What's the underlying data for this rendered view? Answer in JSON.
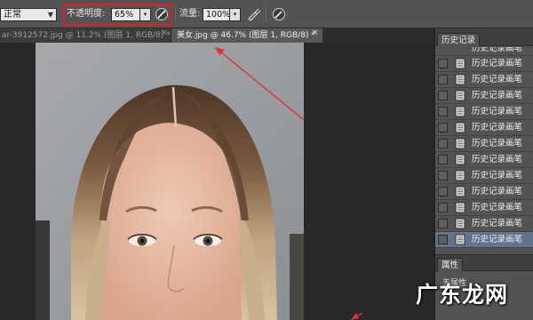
{
  "options_bar": {
    "blend_mode": "正常",
    "opacity_label": "不透明度:",
    "opacity_value": "65%",
    "flow_label": "流量:",
    "flow_value": "100%",
    "icons": [
      "pressure-opacity-icon",
      "airbrush-icon",
      "pressure-size-icon"
    ]
  },
  "doc_tabs": [
    {
      "title": "ar-3912572.jpg @ 11.2% (图层 1, RGB/8) *",
      "active": false
    },
    {
      "title": "美女.jpg @ 46.7% (图层 1, RGB/8) *",
      "active": true
    }
  ],
  "history_panel": {
    "title": "历史记录",
    "items": [
      "历史记录画笔",
      "历史记录画笔",
      "历史记录画笔",
      "历史记录画笔",
      "历史记录画笔",
      "历史记录画笔",
      "历史记录画笔",
      "历史记录画笔",
      "历史记录画笔",
      "历史记录画笔",
      "历史记录画笔",
      "历史记录画笔",
      "历史记录画笔"
    ],
    "selected_index": 12
  },
  "properties_panel": {
    "title": "属性",
    "subtitle": "无属性"
  },
  "watermark": "广东龙网",
  "colors": {
    "highlight_box": "#e02020",
    "annotation_arrow": "#e83030",
    "selected_row": "#62748c",
    "panel_bg": "#535353"
  }
}
